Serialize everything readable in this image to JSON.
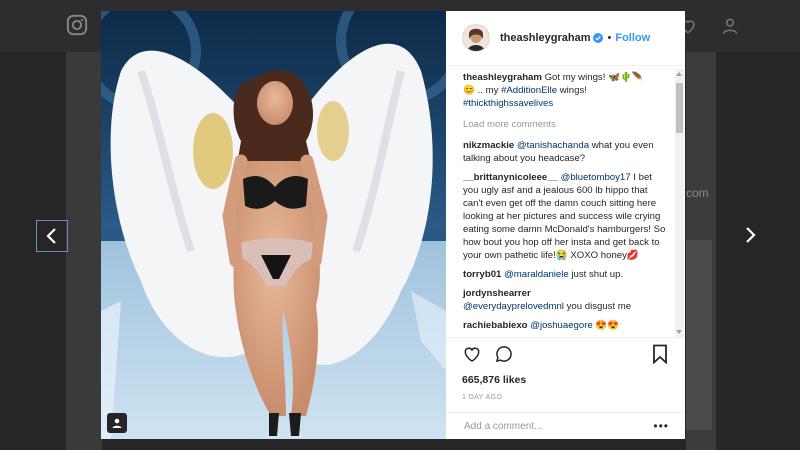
{
  "post": {
    "username": "theashleygraham",
    "follow_label": "Follow",
    "dot": "•",
    "caption_user": "theashleygraham",
    "caption_text_1": " Got my wings! 🦋🌵🪶 ",
    "caption_text_2": "😊 .. my ",
    "caption_tag_1": "#AdditionElle",
    "caption_text_3": " wings! ",
    "caption_tag_2": "#thickthighssavelives",
    "load_more": "Load more comments",
    "likes": "665,876 likes",
    "time_ago": "1 DAY AGO",
    "add_comment_placeholder": "Add a comment...",
    "more_label": "•••"
  },
  "comments": [
    {
      "user": "nikzmackie",
      "mention": "@tanishachanda",
      "text": " what you even talking about you headcase?"
    },
    {
      "user": "__brittanynicoleee__",
      "mention": "@bluetomboy17",
      "text": " I bet you ugly asf and a jealous 600 lb hippo that can't even get off the damn couch sitting here looking at her pictures and success wile crying eating some damn McDonald's hamburgers! So how bout you hop off her insta and get back to your own pathetic life!😭 XOXO honey💋"
    },
    {
      "user": "torryb01",
      "mention": "@maraldaniele",
      "text": " just shut up."
    },
    {
      "user": "jordynshearrer",
      "mention": "@everydayprelovedmnl",
      "text": " you disgust me"
    },
    {
      "user": "rachiebabiexo",
      "mention": "@joshuaegore",
      "text": " 😍😍"
    }
  ],
  "background": {
    "domain_fragment": "com"
  },
  "icons": [
    "instagram-camera-icon",
    "compass-icon",
    "heart-icon",
    "profile-icon",
    "chevron-left-icon",
    "chevron-right-icon",
    "verified-badge-icon",
    "like-heart-icon",
    "comment-bubble-icon",
    "bookmark-icon",
    "user-tag-icon"
  ],
  "colors": {
    "link": "#003569",
    "follow": "#3897f0",
    "verified": "#3897f0",
    "overlay": "#262626"
  }
}
